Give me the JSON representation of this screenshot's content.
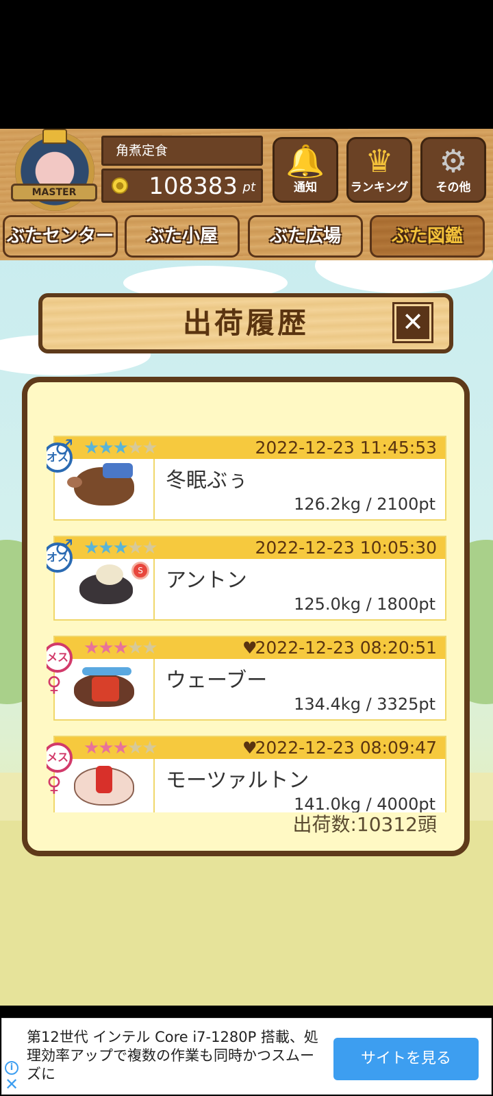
{
  "header": {
    "player_name": "角煮定食",
    "points_value": "108383",
    "points_unit": "pt",
    "badge_label": "MASTER",
    "buttons": [
      {
        "label": "通知",
        "icon": "bell-icon"
      },
      {
        "label": "ランキング",
        "icon": "crown-icon"
      },
      {
        "label": "その他",
        "icon": "gear-icon"
      }
    ],
    "tabs": [
      {
        "label": "ぶたセンター",
        "active": false
      },
      {
        "label": "ぶた小屋",
        "active": false
      },
      {
        "label": "ぶた広場",
        "active": false
      },
      {
        "label": "ぶた図鑑",
        "active": true
      }
    ]
  },
  "dialog": {
    "title": "出荷履歴",
    "close_label": "✕",
    "entries": [
      {
        "gender": "オス",
        "stars": 3,
        "max_stars": 5,
        "favorite": false,
        "timestamp": "2022-12-23 11:45:53",
        "name": "冬眠ぶぅ",
        "stats": "126.2kg / 2100pt"
      },
      {
        "gender": "オス",
        "stars": 3,
        "max_stars": 5,
        "favorite": false,
        "award": "S",
        "timestamp": "2022-12-23 10:05:30",
        "name": "アントン",
        "stats": "125.0kg / 1800pt"
      },
      {
        "gender": "メス",
        "stars": 3,
        "max_stars": 5,
        "favorite": true,
        "timestamp": "2022-12-23 08:20:51",
        "name": "ウェーブー",
        "stats": "134.4kg / 3325pt"
      },
      {
        "gender": "メス",
        "stars": 3,
        "max_stars": 5,
        "favorite": true,
        "timestamp": "2022-12-23 08:09:47",
        "name": "モーツァルトン",
        "stats": "141.0kg / 4000pt"
      }
    ],
    "shipment_count": "出荷数:10312頭"
  },
  "ad": {
    "text": "第12世代 インテル Core i7-1280P 搭載、処理効率アップで複数の作業も同時かつスムーズに",
    "button_label": "サイトを見る"
  },
  "colors": {
    "wood": "#d9a866",
    "panel": "#fff9c4",
    "card_header": "#f6c93e",
    "male": "#2a6ab2",
    "female": "#d23a6a",
    "ad_button": "#3d9ef0"
  }
}
